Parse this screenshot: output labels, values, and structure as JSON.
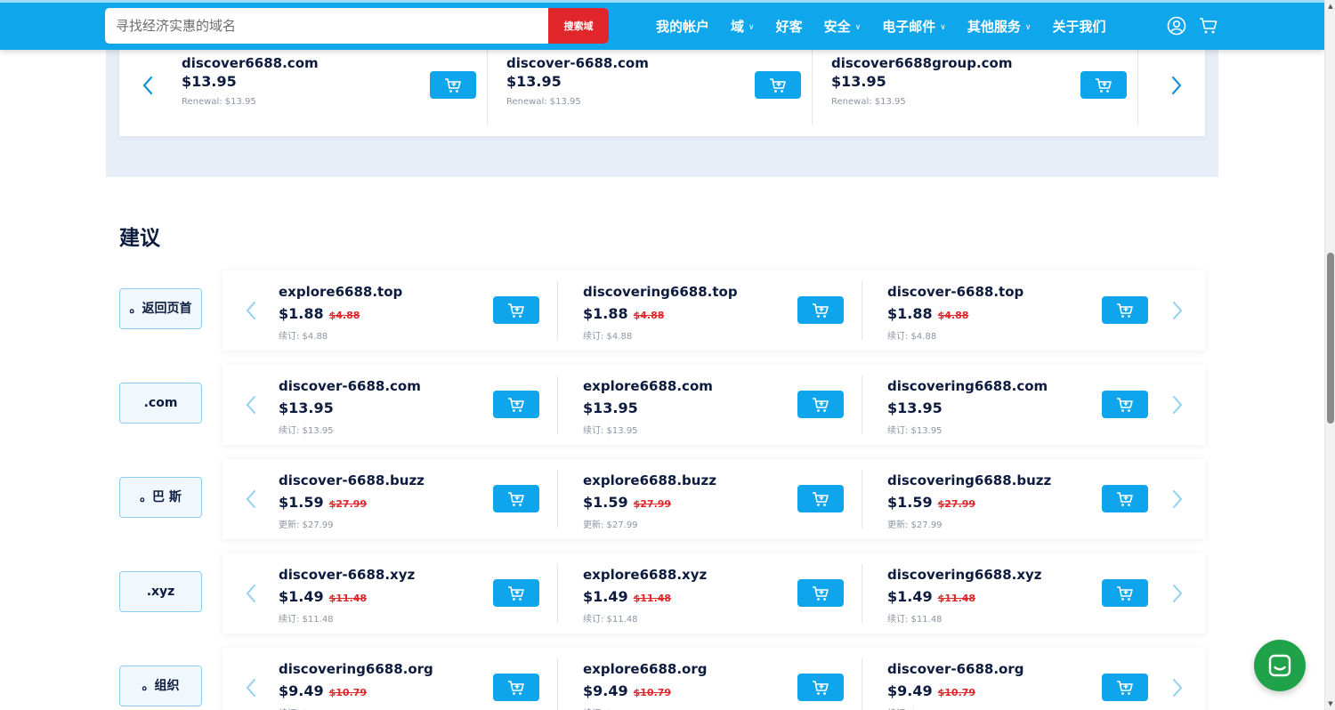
{
  "header": {
    "search_placeholder": "寻找经济实惠的域名",
    "search_button": "搜索域",
    "nav": [
      {
        "label": "我的帐户",
        "dropdown": false
      },
      {
        "label": "域",
        "dropdown": true
      },
      {
        "label": "好客",
        "dropdown": false
      },
      {
        "label": "安全",
        "dropdown": true
      },
      {
        "label": "电子邮件",
        "dropdown": true
      },
      {
        "label": "其他服务",
        "dropdown": true
      },
      {
        "label": "关于我们",
        "dropdown": false
      }
    ],
    "icons": [
      "user-icon",
      "cart-icon"
    ]
  },
  "top_carousel": {
    "items": [
      {
        "domain": "discover6688.com",
        "price": "$13.95",
        "renewal": "Renewal: $13.95"
      },
      {
        "domain": "discover-6688.com",
        "price": "$13.95",
        "renewal": "Renewal: $13.95"
      },
      {
        "domain": "discover6688group.com",
        "price": "$13.95",
        "renewal": "Renewal: $13.95"
      }
    ]
  },
  "suggestions": {
    "title": "建议",
    "rows": [
      {
        "tld": "。返回页首",
        "items": [
          {
            "domain": "explore6688.top",
            "price": "$1.88",
            "old_price": "$4.88",
            "renewal": "续订:  $4.88"
          },
          {
            "domain": "discovering6688.top",
            "price": "$1.88",
            "old_price": "$4.88",
            "renewal": "续订:  $4.88"
          },
          {
            "domain": "discover-6688.top",
            "price": "$1.88",
            "old_price": "$4.88",
            "renewal": "续订:  $4.88"
          }
        ]
      },
      {
        "tld": ".com",
        "items": [
          {
            "domain": "discover-6688.com",
            "price": "$13.95",
            "old_price": "",
            "renewal": "续订:  $13.95"
          },
          {
            "domain": "explore6688.com",
            "price": "$13.95",
            "old_price": "",
            "renewal": "续订:  $13.95"
          },
          {
            "domain": "discovering6688.com",
            "price": "$13.95",
            "old_price": "",
            "renewal": "续订:  $13.95"
          }
        ]
      },
      {
        "tld": "。巴 斯",
        "items": [
          {
            "domain": "discover-6688.buzz",
            "price": "$1.59",
            "old_price": "$27.99",
            "renewal": "更新:  $27.99"
          },
          {
            "domain": "explore6688.buzz",
            "price": "$1.59",
            "old_price": "$27.99",
            "renewal": "更新:  $27.99"
          },
          {
            "domain": "discovering6688.buzz",
            "price": "$1.59",
            "old_price": "$27.99",
            "renewal": "更新:  $27.99"
          }
        ]
      },
      {
        "tld": ".xyz",
        "items": [
          {
            "domain": "discover-6688.xyz",
            "price": "$1.49",
            "old_price": "$11.48",
            "renewal": "续订:  $11.48"
          },
          {
            "domain": "explore6688.xyz",
            "price": "$1.49",
            "old_price": "$11.48",
            "renewal": "续订:  $11.48"
          },
          {
            "domain": "discovering6688.xyz",
            "price": "$1.49",
            "old_price": "$11.48",
            "renewal": "续订:  $11.48"
          }
        ]
      },
      {
        "tld": "。组织",
        "items": [
          {
            "domain": "discovering6688.org",
            "price": "$9.49",
            "old_price": "$10.79",
            "renewal": "续订:  $10.79"
          },
          {
            "domain": "explore6688.org",
            "price": "$9.49",
            "old_price": "$10.79",
            "renewal": "续订:  $10.79"
          },
          {
            "domain": "discover-6688.org",
            "price": "$9.49",
            "old_price": "$10.79",
            "renewal": "续订:  $10.79"
          }
        ]
      }
    ]
  },
  "colors": {
    "header_bg": "#0fa6ec",
    "search_button_bg": "#e0262a",
    "cart_button_bg": "#0ea5ec",
    "old_price": "#e0262a",
    "chat_bg": "#1fa24a"
  },
  "chat": {
    "icon": "chat-icon"
  }
}
